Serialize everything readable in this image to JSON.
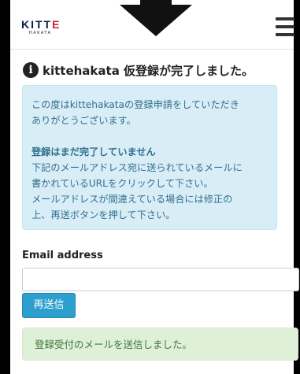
{
  "header": {
    "logo_main": "KITT",
    "logo_main_e": "E",
    "logo_sub": "HAKATA",
    "menu_icon": "hamburger-menu-icon"
  },
  "overlay": {
    "arrow_icon": "down-arrow-icon"
  },
  "notice": {
    "icon": "info-circle-icon",
    "title": "kittehakata 仮登録が完了しました。"
  },
  "info_box": {
    "lines": [
      "この度はkittehakataの登録申請をしていただき",
      "ありがとうございます。",
      "登録はまだ完了していません",
      "下記のメールアドレス宛に送られているメールに",
      "書かれているURLをクリックして下さい。",
      "メールアドレスが間違えている場合には修正の",
      "上、再送ボタンを押して下さい。"
    ]
  },
  "form": {
    "email_label": "Email address",
    "email_value": "",
    "resend_label": "再送信"
  },
  "success_message": "登録受付のメールを送信しました。",
  "colors": {
    "info_bg": "#d9edf7",
    "info_text": "#31708f",
    "button": "#2d9fce",
    "success_bg": "#dff0d8",
    "success_text": "#3c763d",
    "logo_navy": "#0c1f44",
    "logo_red": "#d2232a"
  }
}
